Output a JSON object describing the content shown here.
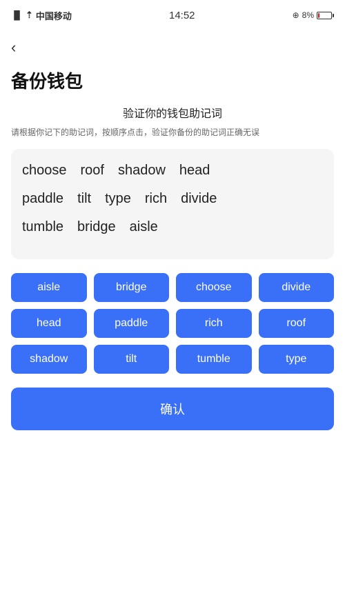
{
  "statusBar": {
    "carrier": "中国移动",
    "time": "14:52",
    "battery": "8%"
  },
  "header": {
    "backLabel": "‹",
    "pageTitle": "备份钱包"
  },
  "section": {
    "title": "验证你的钱包助记词",
    "desc": "请根据你记下的助记词，按顺序点击，验证你备份的助记词正确无误"
  },
  "displayWords": {
    "rows": [
      [
        "choose",
        "roof",
        "shadow",
        "head"
      ],
      [
        "paddle",
        "tilt",
        "type",
        "rich",
        "divide"
      ],
      [
        "tumble",
        "bridge",
        "aisle"
      ]
    ]
  },
  "wordButtons": [
    "aisle",
    "bridge",
    "choose",
    "divide",
    "head",
    "paddle",
    "rich",
    "roof",
    "shadow",
    "tilt",
    "tumble",
    "type"
  ],
  "confirmButton": {
    "label": "确认"
  }
}
